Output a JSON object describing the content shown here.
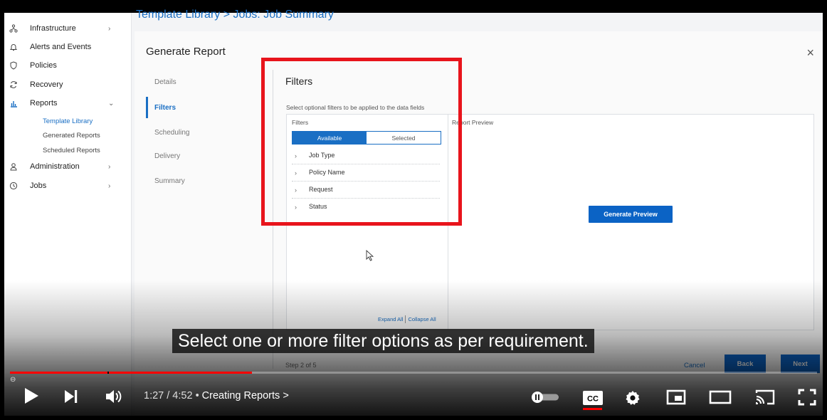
{
  "sidebar": {
    "items": [
      {
        "label": "Infrastructure",
        "icon": "hierarchy-icon"
      },
      {
        "label": "Alerts and Events",
        "icon": "bell-icon"
      },
      {
        "label": "Policies",
        "icon": "shield-icon"
      },
      {
        "label": "Recovery",
        "icon": "refresh-icon"
      },
      {
        "label": "Reports",
        "icon": "bar-chart-icon"
      },
      {
        "label": "Administration",
        "icon": "user-icon"
      },
      {
        "label": "Jobs",
        "icon": "clock-icon"
      }
    ],
    "reports_subitems": [
      "Template Library",
      "Generated Reports",
      "Scheduled Reports"
    ]
  },
  "breadcrumb": "Template Library > Jobs: Job Summary",
  "dialog": {
    "title": "Generate Report",
    "close": "×",
    "steps": [
      "Details",
      "Filters",
      "Scheduling",
      "Delivery",
      "Summary"
    ],
    "heading": "Filters",
    "description": "Select optional filters to be applied to the data fields",
    "filter_panel_label": "Filters",
    "toggle": {
      "available": "Available",
      "selected": "Selected"
    },
    "filters": [
      "Job Type",
      "Policy Name",
      "Request",
      "Status"
    ],
    "expand_all": "Expand All",
    "collapse_all": "Collapse All",
    "preview_label": "Report Preview",
    "generate_preview": "Generate Preview",
    "step_count": "Step 2 of 5",
    "cancel": "Cancel",
    "back": "Back",
    "next": "Next"
  },
  "caption": "Select one or more filter options as per requirement.",
  "player": {
    "time": "1:27 / 4:52",
    "separator": "•",
    "chapter_title": "Creating Reports",
    "chapter_arrow": ">",
    "progress": 0.3,
    "cc_label": "CC",
    "accent": "#ff0000"
  },
  "colors": {
    "brand_blue": "#0b63c5",
    "highlight_red": "#e8141c"
  }
}
